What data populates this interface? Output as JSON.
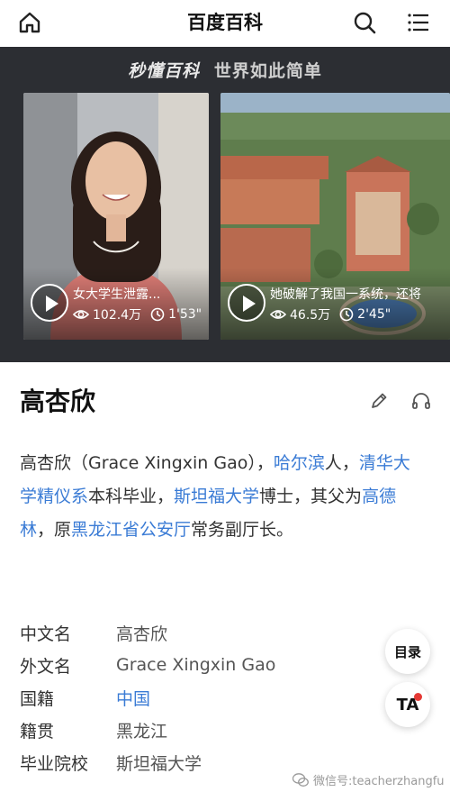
{
  "header": {
    "title": "百度百科",
    "icons": [
      "home-icon",
      "search-icon",
      "menu-icon"
    ]
  },
  "banner": {
    "brand": "秒懂百科",
    "tagline": "世界如此简单",
    "videos": [
      {
        "title": "女大学生泄露...",
        "views": "102.4万",
        "duration": "1'53\""
      },
      {
        "title": "她破解了我国一系统，还将",
        "views": "46.5万",
        "duration": "2'45\""
      }
    ]
  },
  "entry": {
    "name": "高杏欣",
    "summary": {
      "p1": "高杏欣（Grace Xingxin Gao），",
      "link1": "哈尔滨",
      "p2": "人，",
      "link2": "清华大学精仪系",
      "p3": "本科毕业，",
      "link3": "斯坦福大学",
      "p4": "博士，其父为",
      "link4": "高德林",
      "p5": "，原",
      "link5": "黑龙江省公安厅",
      "p6": "常务副厅长。"
    },
    "info": [
      {
        "label": "中文名",
        "value": "高杏欣"
      },
      {
        "label": "外文名",
        "value": "Grace Xingxin Gao"
      },
      {
        "label": "国籍",
        "value": "中国"
      },
      {
        "label": "籍贯",
        "value": "黑龙江"
      },
      {
        "label": "毕业院校",
        "value": "斯坦福大学"
      }
    ]
  },
  "fab": {
    "toc": "目录",
    "ta": "TA"
  },
  "watermark": "微信号:teacherzhangfu",
  "colors": {
    "link": "#3a7bd5",
    "banner_bg": "#2c2e33",
    "badge_dot": "#e53935"
  }
}
